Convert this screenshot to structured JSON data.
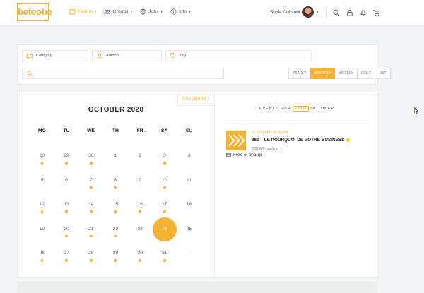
{
  "header": {
    "logo": "betoobe",
    "nav": [
      {
        "label": "Events",
        "icon": "calendar-icon",
        "active": true
      },
      {
        "label": "Groups",
        "icon": "groups-icon",
        "active": false
      },
      {
        "label": "Jobs",
        "icon": "globe-icon",
        "active": false
      },
      {
        "label": "Info",
        "icon": "info-icon",
        "active": false
      }
    ],
    "user_name": "Sonia Colombi",
    "icons": [
      "search-icon",
      "lock-icon",
      "bell-icon",
      "cart-icon"
    ]
  },
  "filters": {
    "category_placeholder": "Category",
    "authors_placeholder": "Authors",
    "tag_placeholder": "Tag",
    "search_value": "",
    "views": [
      "YEARLY",
      "MONTHLY",
      "WEEKLY",
      "DAILY",
      "LIST"
    ],
    "active_view": "MONTHLY"
  },
  "calendar": {
    "next_label": "NOVEMBER",
    "title": "OCTOBER 2020",
    "weekdays": [
      "MO",
      "TU",
      "WE",
      "TH",
      "FR",
      "SA",
      "SU"
    ],
    "days": [
      {
        "n": "28",
        "dot": true
      },
      {
        "n": "29",
        "dot": true
      },
      {
        "n": "30",
        "dot": true
      },
      {
        "n": "1",
        "dot": false
      },
      {
        "n": "2",
        "dot": false
      },
      {
        "n": "3",
        "dot": true
      },
      {
        "n": "4",
        "dot": false
      },
      {
        "n": "5",
        "dot": false
      },
      {
        "n": "6",
        "dot": false
      },
      {
        "n": "7",
        "dot": true
      },
      {
        "n": "8",
        "dot": true
      },
      {
        "n": "9",
        "dot": false
      },
      {
        "n": "10",
        "dot": true
      },
      {
        "n": "11",
        "dot": false
      },
      {
        "n": "12",
        "dot": true
      },
      {
        "n": "13",
        "dot": true
      },
      {
        "n": "14",
        "dot": true
      },
      {
        "n": "15",
        "dot": true
      },
      {
        "n": "16",
        "dot": true
      },
      {
        "n": "17",
        "dot": true
      },
      {
        "n": "18",
        "dot": false
      },
      {
        "n": "19",
        "dot": false
      },
      {
        "n": "20",
        "dot": true
      },
      {
        "n": "21",
        "dot": true
      },
      {
        "n": "22",
        "dot": true
      },
      {
        "n": "23",
        "dot": false
      },
      {
        "n": "24",
        "dot": false,
        "selected": true
      },
      {
        "n": "25",
        "dot": false
      },
      {
        "n": "26",
        "dot": true
      },
      {
        "n": "27",
        "dot": true
      },
      {
        "n": "28",
        "dot": true
      },
      {
        "n": "29",
        "dot": true
      },
      {
        "n": "30",
        "dot": true
      },
      {
        "n": "31",
        "dot": true
      },
      {
        "n": "1",
        "dot": false,
        "muted": true
      }
    ]
  },
  "events": {
    "heading_prefix": "EVENTS FOR",
    "heading_day": "24TH",
    "heading_suffix": "OCTOBER",
    "items": [
      {
        "time": "9:00 AM - 9:30 AM",
        "title": "360 – LE POURQUOI DE VOTRE BUSINESS",
        "location": "ZOOM meeting",
        "price": "Free of charge"
      }
    ]
  },
  "colors": {
    "accent": "#f5b335",
    "badge": "#f5d321"
  }
}
